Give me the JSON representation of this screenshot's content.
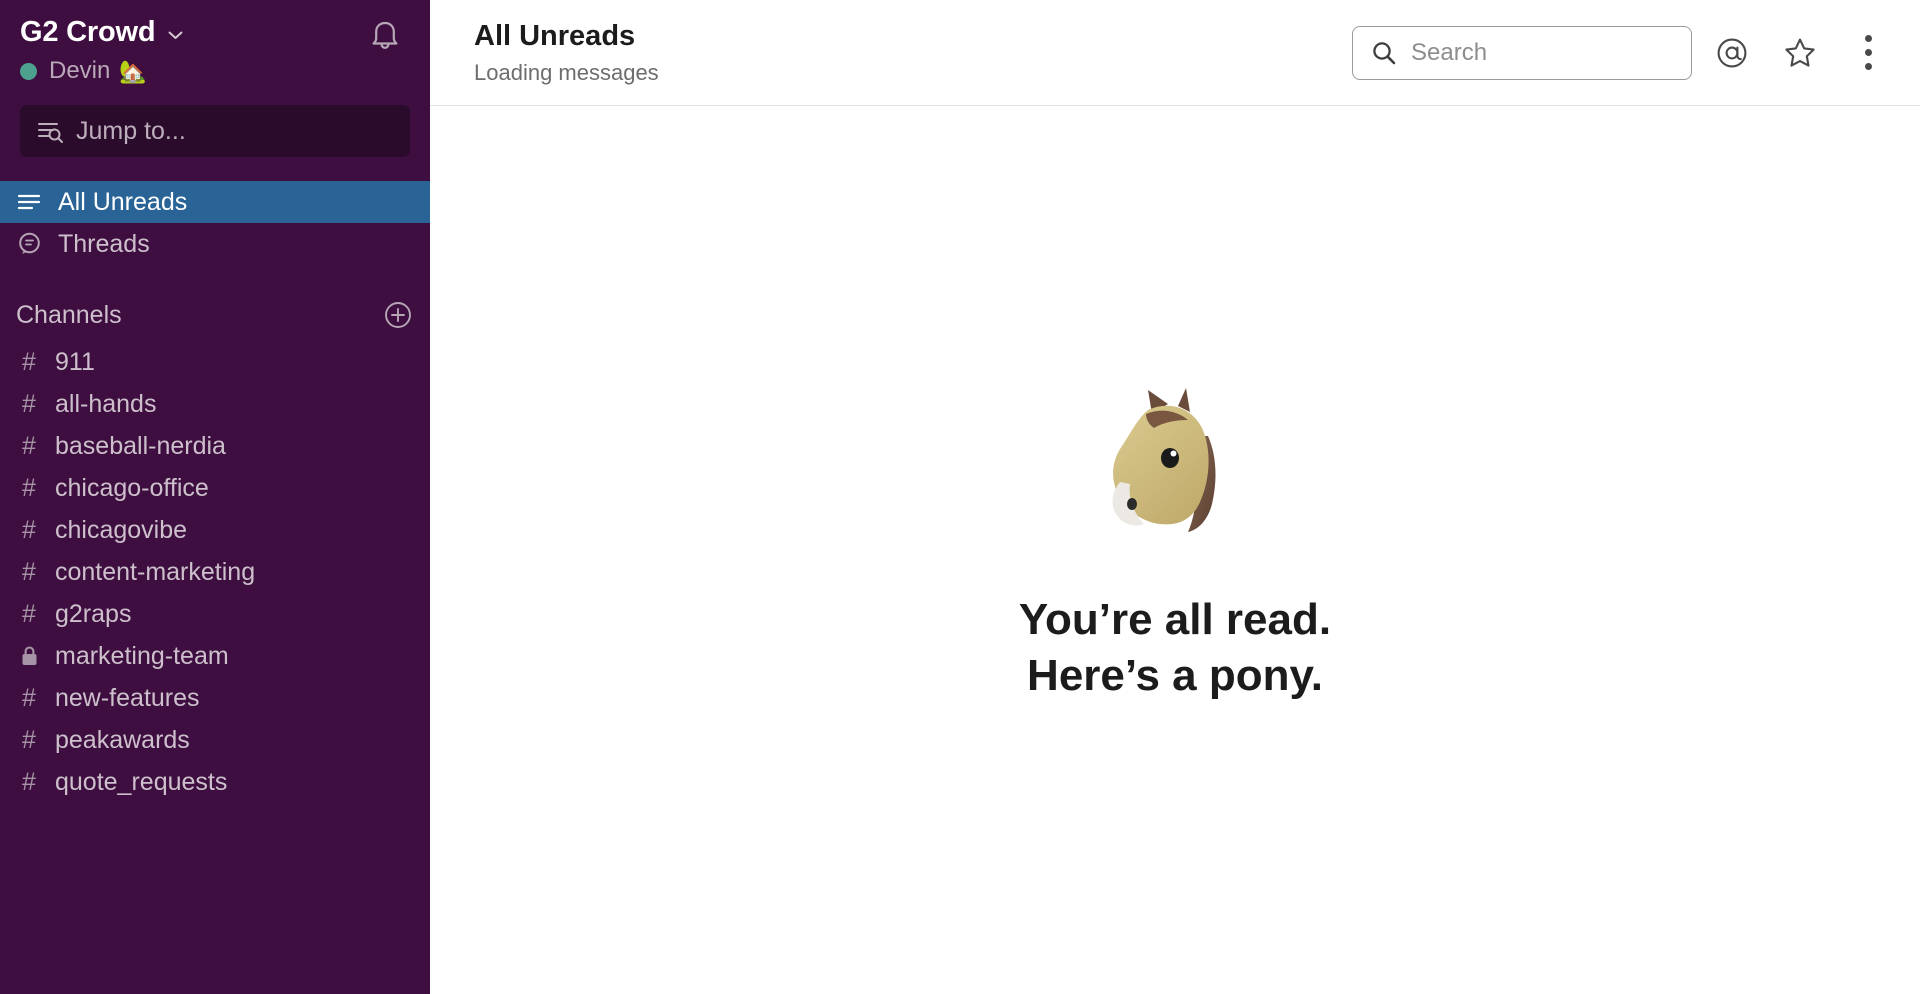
{
  "colors": {
    "sidebar_bg": "#3D0E3F",
    "sidebar_search_bg": "#2A0B2C",
    "active_item_bg": "#2A6496",
    "presence_online": "#4EA08F",
    "sidebar_text": "#CDC0CC",
    "main_text": "#1D1C1D"
  },
  "sidebar": {
    "team_name": "G2 Crowd",
    "team_chevron_icon": "chevron-down-icon",
    "notifications_icon": "bell-icon",
    "user": {
      "name": "Devin",
      "status_emoji": "🏡",
      "presence": "online"
    },
    "jump_to": {
      "label": "Jump to...",
      "icon": "jump-to-icon"
    },
    "nav": [
      {
        "label": "All Unreads",
        "icon": "unreads-list-icon",
        "active": true
      },
      {
        "label": "Threads",
        "icon": "threads-bubble-icon",
        "active": false
      }
    ],
    "channels_section": {
      "title": "Channels",
      "add_icon": "plus-circle-icon",
      "items": [
        {
          "name": "911",
          "sigil": "#",
          "private": false
        },
        {
          "name": "all-hands",
          "sigil": "#",
          "private": false
        },
        {
          "name": "baseball-nerdia",
          "sigil": "#",
          "private": false
        },
        {
          "name": "chicago-office",
          "sigil": "#",
          "private": false
        },
        {
          "name": "chicagovibe",
          "sigil": "#",
          "private": false
        },
        {
          "name": "content-marketing",
          "sigil": "#",
          "private": false
        },
        {
          "name": "g2raps",
          "sigil": "#",
          "private": false
        },
        {
          "name": "marketing-team",
          "sigil": "lock",
          "private": true
        },
        {
          "name": "new-features",
          "sigil": "#",
          "private": false
        },
        {
          "name": "peakawards",
          "sigil": "#",
          "private": false
        },
        {
          "name": "quote_requests",
          "sigil": "#",
          "private": false
        }
      ]
    }
  },
  "topbar": {
    "title": "All Unreads",
    "subtitle": "Loading messages",
    "search": {
      "placeholder": "Search",
      "value": "",
      "icon": "search-icon"
    },
    "actions": [
      {
        "icon": "at-mention-icon",
        "name": "mentions-button"
      },
      {
        "icon": "star-outline-icon",
        "name": "starred-button"
      },
      {
        "icon": "more-vertical-icon",
        "name": "more-options-button"
      }
    ]
  },
  "main": {
    "empty_state": {
      "emoji": "🐴",
      "emoji_name": "horse-face-emoji",
      "line1": "You’re all read.",
      "line2": "Here’s a pony."
    }
  }
}
